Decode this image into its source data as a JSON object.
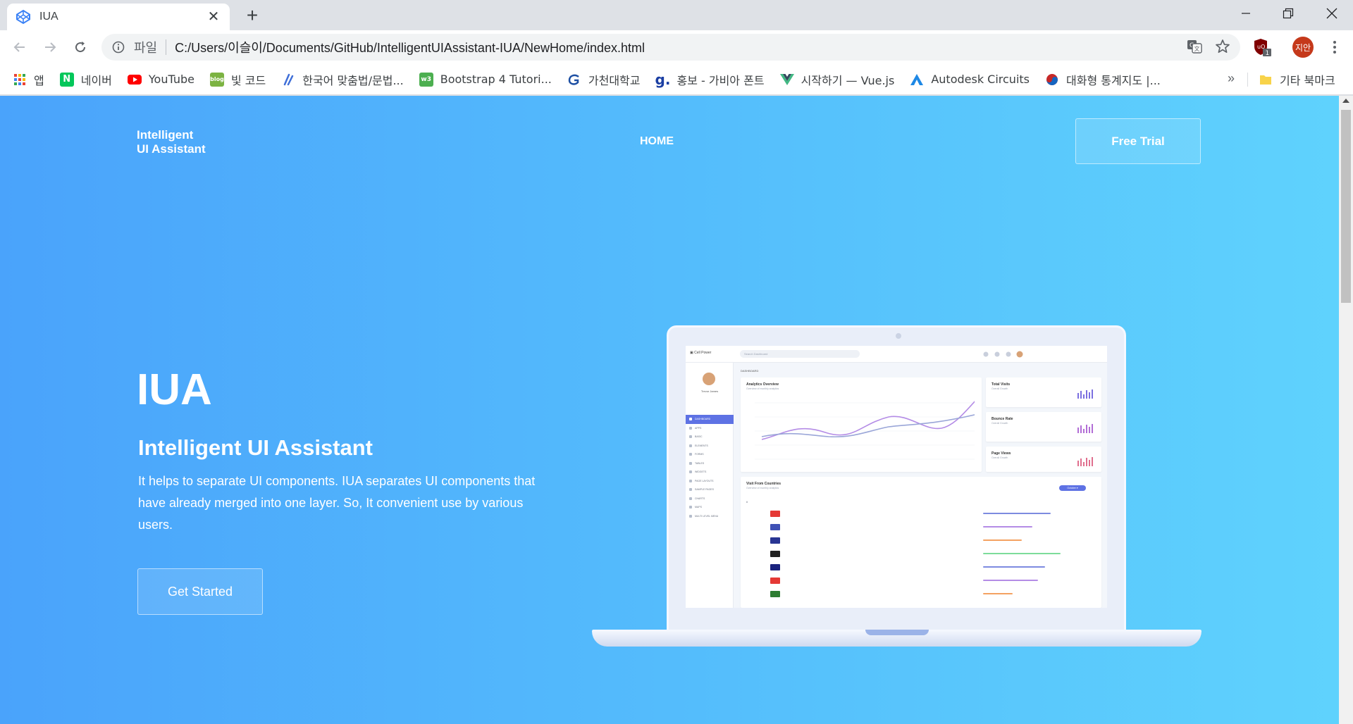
{
  "browser": {
    "tab_title": "IUA",
    "url_scheme_label": "파일",
    "url": "C:/Users/이슬이/Documents/GitHub/IntelligentUIAssistant-IUA/NewHome/index.html",
    "profile_initials": "지안",
    "extension_badge": "1"
  },
  "bookmarks": [
    {
      "label": "앱",
      "icon": "apps-grid-icon",
      "color": "#ea4335"
    },
    {
      "label": "네이버",
      "icon": "naver-icon",
      "color": "#03c75a"
    },
    {
      "label": "YouTube",
      "icon": "youtube-icon",
      "color": "#ff0000"
    },
    {
      "label": "빛 코드",
      "icon": "blog-icon",
      "color": "#7cb342"
    },
    {
      "label": "한국어 맞춤법/문법...",
      "icon": "spellcheck-icon",
      "color": "#3f6fd8"
    },
    {
      "label": "Bootstrap 4 Tutori...",
      "icon": "w3-icon",
      "color": "#4caf50"
    },
    {
      "label": "가천대학교",
      "icon": "gachon-icon",
      "color": "#1d4fa3"
    },
    {
      "label": "홍보 - 가비아 폰트",
      "icon": "gabia-icon",
      "color": "#1b3fa3"
    },
    {
      "label": "시작하기 — Vue.js",
      "icon": "vue-icon",
      "color": "#41b883"
    },
    {
      "label": "Autodesk Circuits",
      "icon": "autodesk-icon",
      "color": "#1e88e5"
    },
    {
      "label": "대화형 통계지도 |...",
      "icon": "korea-flag-icon",
      "color": "#c62828"
    }
  ],
  "bookmarks_overflow": "»",
  "bookmarks_other": "기타 북마크",
  "site": {
    "brand_line1": "Intelligent",
    "brand_line2": "UI Assistant",
    "nav_home": "HOME",
    "free_trial": "Free Trial",
    "hero_title": "IUA",
    "hero_subtitle": "Intelligent UI Assistant",
    "hero_description": "It helps to separate UI components. IUA separates UI components that have already merged into one layer. So, It convenient use by various users.",
    "get_started": "Get Started"
  },
  "colors": {
    "page_gradient_start": "#4aa3fb",
    "page_gradient_end": "#5fd2fd",
    "mockup_accent": "#5e72e4"
  }
}
